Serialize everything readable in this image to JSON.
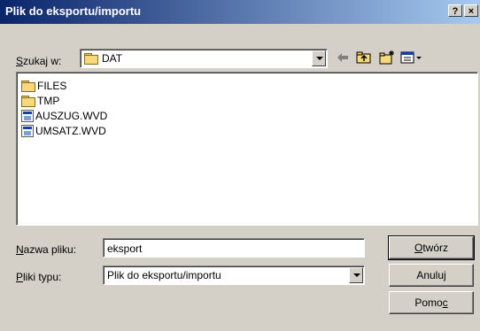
{
  "window": {
    "title": "Plik do eksportu/importu",
    "help_label": "?",
    "close_label": "×"
  },
  "lookin": {
    "label_pre": "",
    "label_key": "S",
    "label_post": "zukaj w:",
    "value": "DAT",
    "value_icon": "folder-icon"
  },
  "toolbar": {
    "icons": [
      "back-arrow-icon",
      "up-folder-icon",
      "new-folder-icon",
      "view-menu-icon"
    ]
  },
  "files": [
    {
      "name": "FILES",
      "icon": "folder-icon"
    },
    {
      "name": "TMP",
      "icon": "folder-icon"
    },
    {
      "name": "AUSZUG.WVD",
      "icon": "file-icon"
    },
    {
      "name": "UMSATZ.WVD",
      "icon": "file-icon"
    }
  ],
  "filename": {
    "label_key": "N",
    "label_post": "azwa pliku:",
    "value": "eksport"
  },
  "filetype": {
    "label_key": "P",
    "label_post": "liki typu:",
    "value": "Plik do eksportu/importu"
  },
  "buttons": {
    "open": {
      "key": "O",
      "post": "twórz",
      "pre": ""
    },
    "cancel": "Anuluj",
    "help": {
      "pre": "Pomo",
      "key": "c",
      "post": ""
    }
  },
  "colors": {
    "titlebar_start": "#0a246a",
    "titlebar_end": "#a6caf0",
    "face": "#d4d0c8"
  }
}
